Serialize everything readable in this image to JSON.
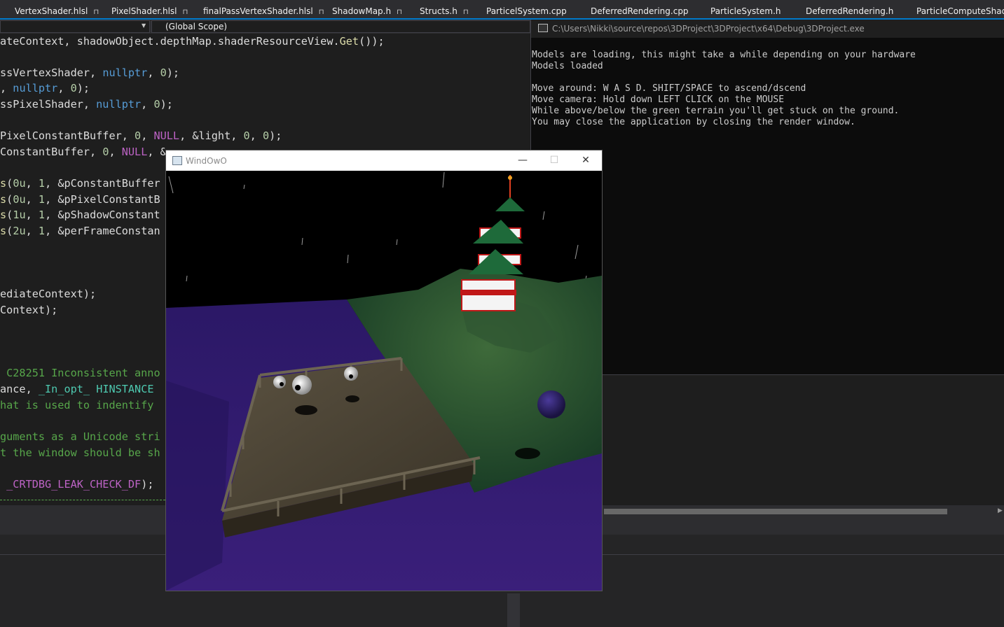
{
  "tabs": [
    "VertexShader.hlsl",
    "PixelShader.hlsl",
    "finalPassVertexShader.hlsl",
    "ShadowMap.h",
    "Structs.h",
    "ParticelSystem.cpp",
    "DeferredRendering.cpp",
    "ParticleSystem.h",
    "DeferredRendering.h",
    "ParticleComputeShader"
  ],
  "navbar": {
    "scope": "(Global Scope)"
  },
  "code_lines": [
    {
      "text": "ateContext, shadowObject.depthMap.shaderResourceView.Get());"
    },
    {
      "text": ""
    },
    {
      "text": "ssVertexShader, nullptr, 0);"
    },
    {
      "text": ", nullptr, 0);"
    },
    {
      "text": "ssPixelShader, nullptr, 0);"
    },
    {
      "text": ""
    },
    {
      "text": "PixelConstantBuffer, 0, NULL, &light, 0, 0);"
    },
    {
      "text": "ConstantBuffer, 0, NULL, &"
    },
    {
      "text": ""
    },
    {
      "text": "s(0u, 1, &pConstantBuffer"
    },
    {
      "text": "s(0u, 1, &pPixelConstantB"
    },
    {
      "text": "s(1u, 1, &pShadowConstant"
    },
    {
      "text": "s(2u, 1, &perFrameConstan"
    },
    {
      "text": ""
    },
    {
      "text": ""
    },
    {
      "text": "ediateContext);"
    },
    {
      "text": "Context);"
    },
    {
      "text": ""
    },
    {
      "text": ""
    },
    {
      "text": " C28251 Inconsistent anno"
    },
    {
      "text": "ance, _In_opt_ HINSTANCE "
    },
    {
      "text": "hat is used to indentify "
    },
    {
      "text": ""
    },
    {
      "text": "guments as a Unicode stri"
    },
    {
      "text": "t the window should be sh"
    },
    {
      "text": ""
    },
    {
      "text": " _CRTDBG_LEAK_CHECK_DF);"
    }
  ],
  "console": {
    "title": "C:\\Users\\Nikki\\source\\repos\\3DProject\\3DProject\\x64\\Debug\\3DProject.exe",
    "lines": [
      "",
      "Models are loading, this might take a while depending on your hardware",
      "Models loaded",
      "",
      "Move around: W A S D. SHIFT/SPACE to ascend/dscend",
      "Move camera: Hold down LEFT CLICK on the MOUSE",
      "While above/below the green terrain you'll get stuck on the ground.",
      "You may close the application by closing the render window."
    ]
  },
  "render_window": {
    "title": "WindOwO",
    "minimize": "—",
    "maximize": "☐",
    "close": "✕"
  },
  "colors": {
    "editor_bg": "#1e1e1e",
    "accent": "#007acc",
    "console_bg": "#0c0c0c",
    "water": "#2a1760",
    "terrain": "#1d4a2a",
    "deck": "#4a4030"
  },
  "icons": [
    "pin-icon",
    "console-app-icon",
    "render-window-icon",
    "minimize-icon",
    "maximize-icon",
    "close-icon"
  ]
}
